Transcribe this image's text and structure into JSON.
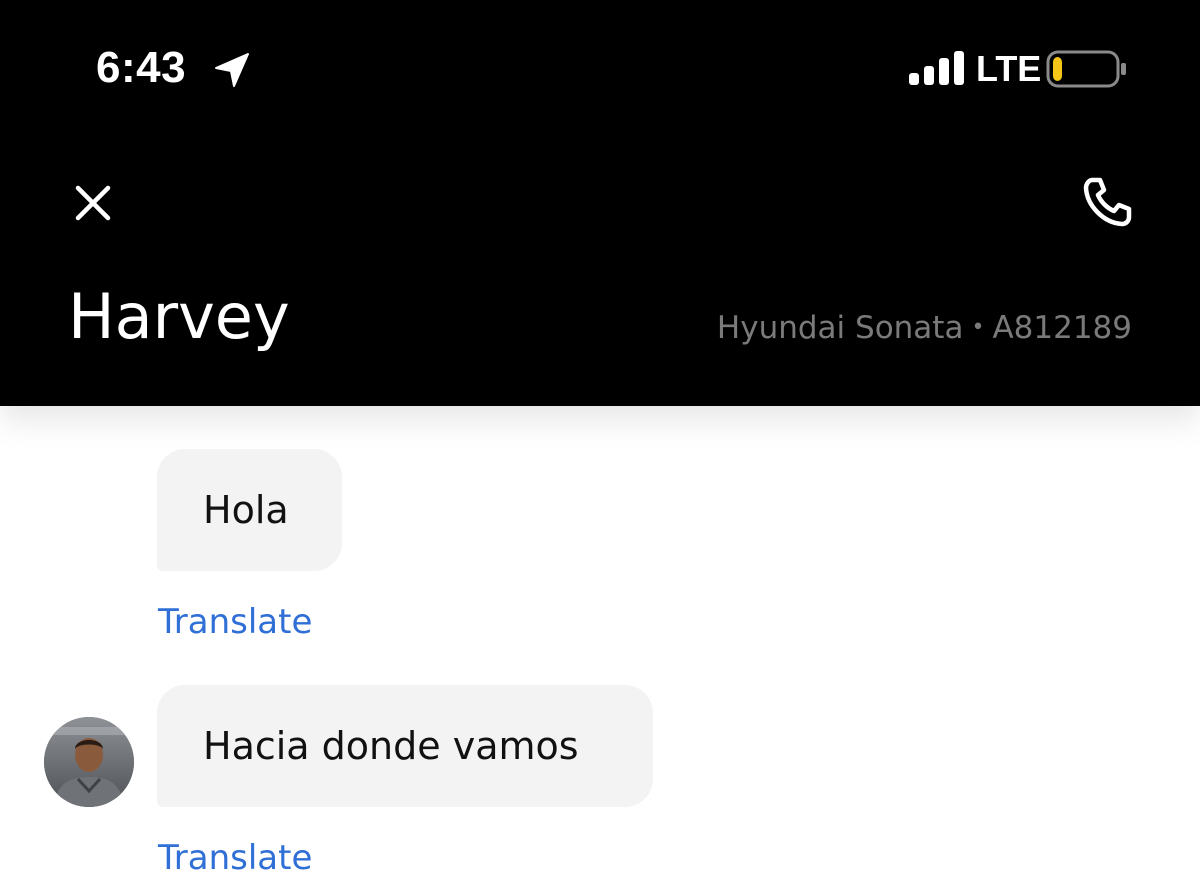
{
  "status_bar": {
    "time": "6:43",
    "location_icon": "location-arrow-icon",
    "signal_icon": "cellular-signal-icon",
    "network": "LTE",
    "battery_icon": "battery-low-icon",
    "battery_level": 0.15,
    "battery_color": "#f5c518"
  },
  "header": {
    "close_icon": "close-icon",
    "call_icon": "phone-icon",
    "contact_name": "Harvey",
    "vehicle_model": "Hyundai Sonata",
    "separator": "•",
    "plate": "A812189",
    "background": "#000000"
  },
  "messages": [
    {
      "text": "Hola",
      "translate_label": "Translate"
    },
    {
      "text": "Hacia donde vamos",
      "translate_label": "Translate",
      "avatar": "driver-avatar"
    }
  ],
  "colors": {
    "link": "#2f6fd6",
    "bubble": "#f3f3f3",
    "muted_text": "#7a7a7a"
  }
}
